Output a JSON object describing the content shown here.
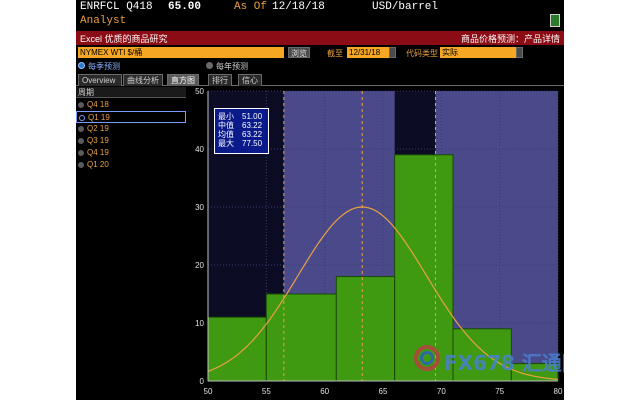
{
  "header": {
    "ticker": "ENRFCL Q418",
    "price": "65.00",
    "asof_label": "As Of",
    "asof_date": "12/18/18",
    "units": "USD/barrel",
    "subtitle": "Analyst"
  },
  "redbar": {
    "left_text": "Excel  优质的商品研究",
    "right_text": "商品价格预测：产品详情"
  },
  "controls": {
    "security_field": "NYMEX WTI $/桶",
    "browse_button": "浏览",
    "cutoff_label": "截至",
    "cutoff_date": "12/31/18",
    "code_type_label": "代码类型",
    "code_type_value": "实际"
  },
  "radios": {
    "quarterly": "每季预测",
    "annual": "每年预测"
  },
  "tabs": [
    "Overview",
    "曲线分析",
    "直方图",
    "排行",
    "信心"
  ],
  "active_tab": 2,
  "period_header": "周期",
  "periods": [
    "Q4 18",
    "Q1 19",
    "Q2 19",
    "Q3 19",
    "Q4 19",
    "Q1 20"
  ],
  "selected_period": 1,
  "stats": [
    {
      "label": "最小",
      "value": "51.00"
    },
    {
      "label": "中值",
      "value": "63.22"
    },
    {
      "label": "均值",
      "value": "63.22"
    },
    {
      "label": "最大",
      "value": "77.50"
    }
  ],
  "watermark": "FX678 汇通网",
  "colors": {
    "accent_orange": "#f5a623",
    "title_red": "#8b0c14",
    "bar_green": "#3f9a12",
    "curve_orange": "#e8a040",
    "band_purple": "#4a4a8a"
  },
  "chart_data": {
    "type": "bar",
    "x_ticks": [
      50,
      55,
      60,
      65,
      70,
      75,
      80
    ],
    "y_ticks": [
      0,
      10,
      20,
      30,
      40,
      50
    ],
    "xlim": [
      50,
      80
    ],
    "ylim": [
      0,
      50
    ],
    "bins": [
      {
        "x0": 50,
        "x1": 55,
        "value": 11
      },
      {
        "x0": 55,
        "x1": 61,
        "value": 15
      },
      {
        "x0": 61,
        "x1": 66,
        "value": 18
      },
      {
        "x0": 66,
        "x1": 71,
        "value": 39
      },
      {
        "x0": 71,
        "x1": 76,
        "value": 9
      },
      {
        "x0": 76,
        "x1": 80,
        "value": 3
      }
    ],
    "normal_curve": {
      "mean": 63.22,
      "sd": 5.5,
      "peak": 30
    },
    "vlines": [
      56.5,
      63.22,
      69.5
    ],
    "bands": [
      [
        56.5,
        66
      ],
      [
        69.5,
        80
      ]
    ],
    "grid": true
  }
}
